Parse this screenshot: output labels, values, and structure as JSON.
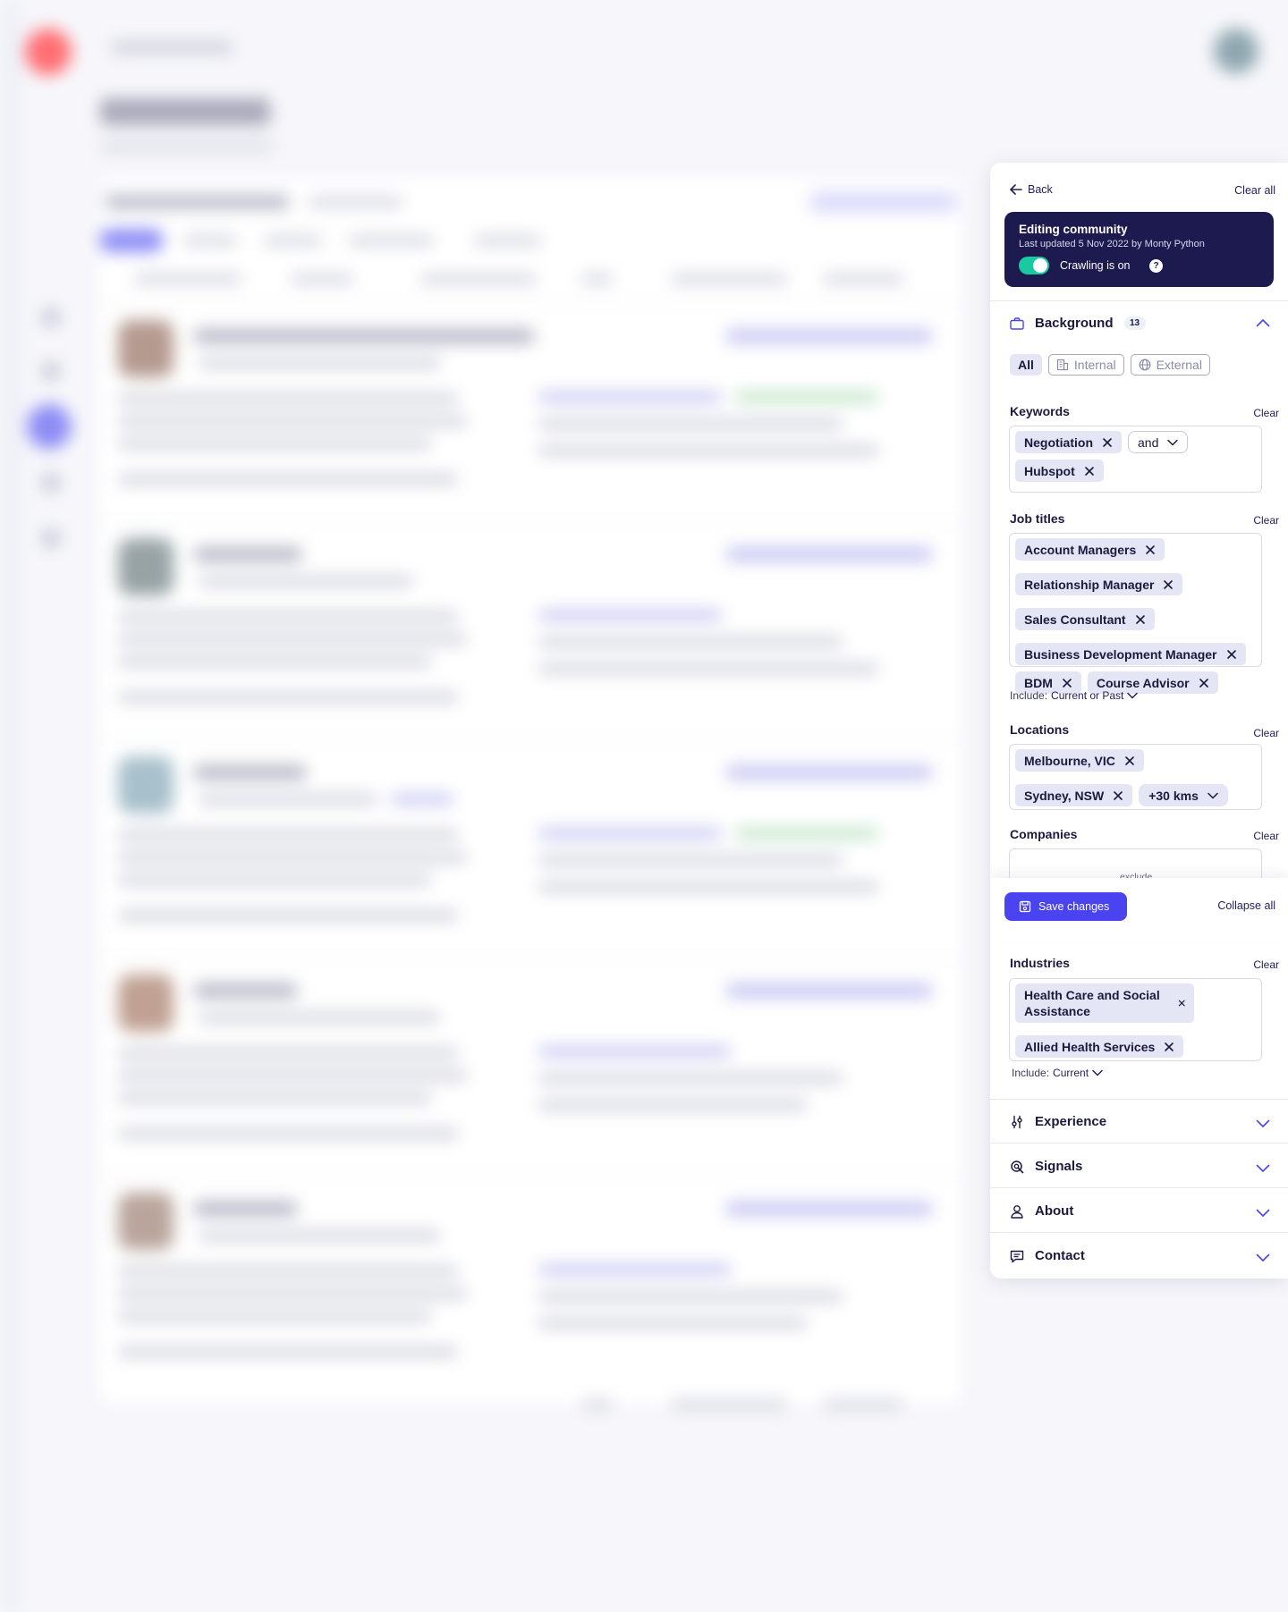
{
  "panel": {
    "back_label": "Back",
    "clear_all_label": "Clear all",
    "editing": {
      "title": "Editing community",
      "meta": "Last updated 5 Nov 2022 by Monty Python",
      "crawling_label": "Crawling is on",
      "crawling_on": true,
      "help_glyph": "?"
    },
    "background": {
      "title": "Background",
      "count": "13",
      "segments": [
        "All",
        "Internal",
        "External"
      ],
      "active_segment": "All",
      "keywords": {
        "label": "Keywords",
        "clear": "Clear",
        "chips": [
          "Negotiation",
          "Hubspot"
        ],
        "operator": "and"
      },
      "job_titles": {
        "label": "Job titles",
        "clear": "Clear",
        "chips": [
          "Account Managers",
          "Relationship Manager",
          "Sales Consultant",
          "Business Development Manager",
          "BDM",
          "Course Advisor"
        ],
        "include_prefix": "Include:",
        "include_value": "Current or Past"
      },
      "locations": {
        "label": "Locations",
        "clear": "Clear",
        "chips": [
          "Melbourne, VIC",
          "Sydney, NSW"
        ],
        "radius": "+30 kms"
      },
      "companies": {
        "label": "Companies",
        "clear": "Clear",
        "exclude_hint": "exclude"
      },
      "industries": {
        "label": "Industries",
        "clear": "Clear",
        "chips": [
          "Health Care and Social Assistance",
          "Allied Health Services"
        ],
        "include_prefix": "Include:",
        "include_value": "Current"
      }
    },
    "actions": {
      "save_label": "Save changes",
      "collapse_label": "Collapse all"
    },
    "collapsed_sections": [
      {
        "label": "Experience",
        "icon": "sliders-icon"
      },
      {
        "label": "Signals",
        "icon": "signal-icon"
      },
      {
        "label": "About",
        "icon": "user-icon"
      },
      {
        "label": "Contact",
        "icon": "chat-icon"
      }
    ],
    "colors": {
      "primary": "#4a44f0",
      "dark_card": "#1c1a4e",
      "toggle_on": "#19c9a1",
      "chip_bg": "#e4e6f6"
    }
  }
}
